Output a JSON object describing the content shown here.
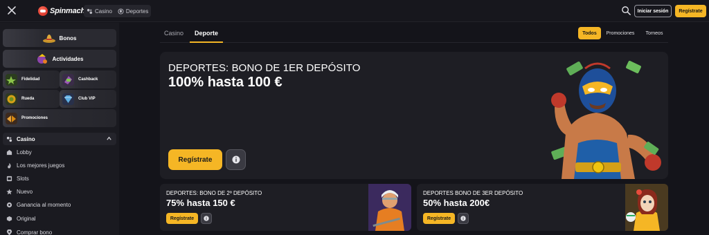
{
  "header": {
    "logo": "Spinmacho",
    "modes": [
      {
        "label": "Casino",
        "icon": "casino-icon"
      },
      {
        "label": "Deportes",
        "icon": "sports-ball-icon"
      }
    ],
    "login_label": "Iniciar sesión",
    "register_label": "Regístrate"
  },
  "sidebar": {
    "bonos": "Bonos",
    "actividades": "Actividades",
    "grid": [
      {
        "label": "Fidelidad",
        "icon": "loyalty-icon"
      },
      {
        "label": "Cashback",
        "icon": "cashback-icon"
      },
      {
        "label": "Rueda",
        "icon": "wheel-icon"
      },
      {
        "label": "Club VIP",
        "icon": "vip-diamond-icon"
      },
      {
        "label": "Promociones",
        "icon": "promo-icon"
      }
    ],
    "casino_section": "Casino",
    "nav": [
      {
        "label": "Lobby",
        "icon": "lobby-icon"
      },
      {
        "label": "Los mejores juegos",
        "icon": "fire-icon"
      },
      {
        "label": "Slots",
        "icon": "slots-icon"
      },
      {
        "label": "Nuevo",
        "icon": "star-icon"
      },
      {
        "label": "Ganancia al momento",
        "icon": "instant-win-icon"
      },
      {
        "label": "Original",
        "icon": "original-icon"
      },
      {
        "label": "Comprar bono",
        "icon": "buy-bonus-icon"
      }
    ]
  },
  "main": {
    "tabs": [
      "Casino",
      "Deporte"
    ],
    "active_tab": "Deporte",
    "filters": [
      "Todos",
      "Promociones",
      "Torneos"
    ],
    "active_filter": "Todos",
    "hero": {
      "title": "DEPORTES: BONO DE 1ER DEPÓSITO",
      "subtitle": "100% hasta 100 €",
      "cta": "Regístrate"
    },
    "cards": [
      {
        "title": "DEPORTES: BONO DE 2º DEPÓSITO",
        "subtitle": "75% hasta 150 €",
        "cta": "Regístrate"
      },
      {
        "title": "DEPORTES BONO DE 3ER DEPÓSITO",
        "subtitle": "50% hasta 200€",
        "cta": "Regístrate"
      }
    ]
  },
  "colors": {
    "accent": "#f5b625",
    "background": "#14141a",
    "panel": "#1e1e24"
  }
}
